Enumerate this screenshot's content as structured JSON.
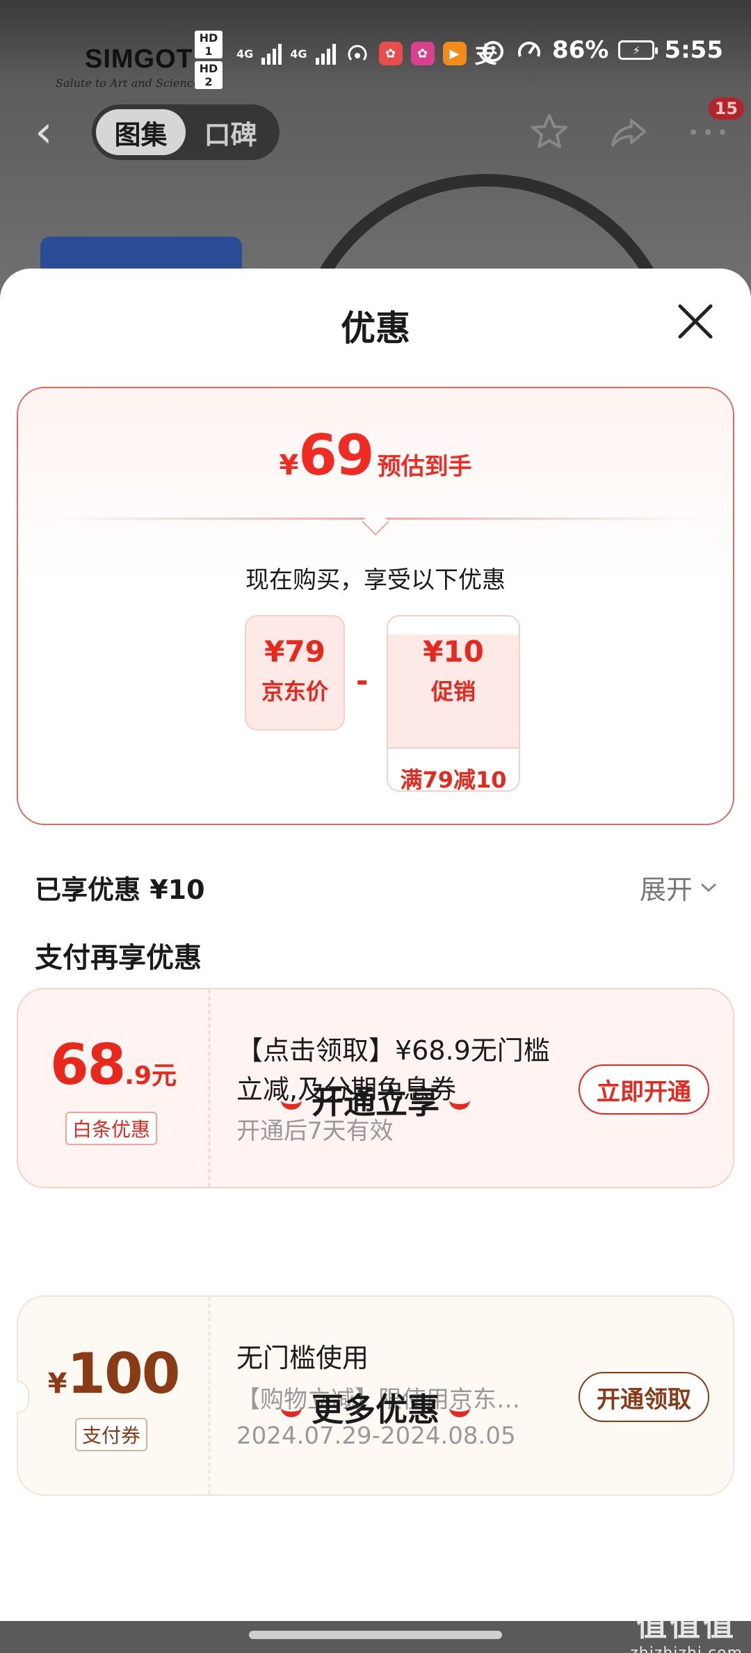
{
  "status_bar": {
    "hd1": "HD 1",
    "hd2": "HD 2",
    "net1": "4G",
    "net2": "4G",
    "battery_percent": "86%",
    "time": "5:55"
  },
  "brand": {
    "name": "SIMGOT",
    "slogan": "Salute to Art and Science"
  },
  "nav": {
    "tabs": [
      {
        "label": "图集",
        "active": true
      },
      {
        "label": "口碑",
        "active": false
      }
    ],
    "notification_count": "15"
  },
  "sheet": {
    "title": "优惠",
    "summary": {
      "currency": "¥",
      "estimated_price": "69",
      "estimated_label": "预估到手",
      "buy_now_text": "现在购买，享受以下优惠",
      "jd_price_value": "¥79",
      "jd_price_label": "京东价",
      "minus": "-",
      "promo_value": "¥10",
      "promo_label": "促销",
      "promo_condition": "满79减10"
    },
    "enjoyed_text": "已享优惠 ¥10",
    "expand_label": "展开",
    "pay_more_title": "支付再享优惠",
    "coupons": [
      {
        "amount_main": "68",
        "amount_unit": ".9元",
        "tag": "白条优惠",
        "title": "【点击领取】¥68.9无门槛立减,及分期免息券",
        "sub": "开通后7天有效",
        "action": "立即开通"
      },
      {
        "currency": "¥",
        "amount_main": "100",
        "tag": "支付券",
        "title": "无门槛使用",
        "sub": "【购物立减】限使用京东支付",
        "date_range": "2024.07.29-2024.08.05",
        "action": "开通领取"
      }
    ],
    "section_open_enjoy": "开通立享",
    "section_more": "更多优惠"
  },
  "watermark": {
    "line1": "值值值",
    "line2": "zhizhizhi.com"
  },
  "colors": {
    "accent_red": "#e8271d",
    "brown": "#8a3b16",
    "sheet_bg": "#ffffff",
    "overlay": "#6a6a6a"
  }
}
